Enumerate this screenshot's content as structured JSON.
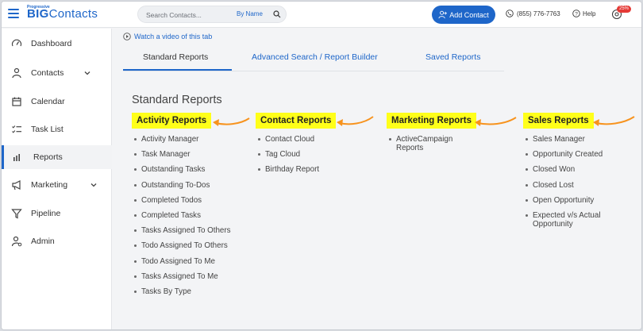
{
  "header": {
    "logo_small": "Progressive",
    "logo_big": "BIG",
    "logo_rest": "Contacts",
    "search_placeholder": "Search Contacts...",
    "search_filter": "By Name",
    "add_contact_label": "Add Contact",
    "phone": "(855) 776-7763",
    "help": "Help",
    "badge": "25%"
  },
  "sidebar": {
    "items": [
      {
        "label": "Dashboard",
        "icon": "gauge-icon"
      },
      {
        "label": "Contacts",
        "icon": "person-icon"
      },
      {
        "label": "Calendar",
        "icon": "calendar-icon"
      },
      {
        "label": "Task List",
        "icon": "checklist-icon"
      },
      {
        "label": "Reports",
        "icon": "bar-chart-icon"
      },
      {
        "label": "Marketing",
        "icon": "megaphone-icon"
      },
      {
        "label": "Pipeline",
        "icon": "funnel-icon"
      },
      {
        "label": "Admin",
        "icon": "admin-icon"
      }
    ],
    "active": "Reports"
  },
  "main": {
    "video_link": "Watch a video of this tab",
    "tabs": [
      {
        "label": "Standard Reports"
      },
      {
        "label": "Advanced Search / Report Builder"
      },
      {
        "label": "Saved Reports"
      }
    ],
    "active_tab": "Standard Reports",
    "section_title": "Standard Reports",
    "columns": [
      {
        "title": "Activity Reports",
        "items": [
          "Activity Manager",
          "Task Manager",
          "Outstanding Tasks",
          "Outstanding To-Dos",
          "Completed Todos",
          "Completed Tasks",
          "Tasks Assigned To Others",
          "Todo Assigned To Others",
          "Todo Assigned To Me",
          "Tasks Assigned To Me",
          "Tasks By Type"
        ]
      },
      {
        "title": "Contact Reports",
        "items": [
          "Contact Cloud",
          "Tag Cloud",
          "Birthday Report"
        ]
      },
      {
        "title": "Marketing Reports",
        "items": [
          "ActiveCampaign Reports"
        ]
      },
      {
        "title": "Sales Reports",
        "items": [
          "Sales Manager",
          "Opportunity Created",
          "Closed Won",
          "Closed Lost",
          "Open Opportunity",
          "Expected v/s Actual Opportunity"
        ]
      }
    ]
  },
  "colors": {
    "accent": "#1e66c9",
    "highlight": "#ffff1a",
    "arrow": "#f7931e",
    "badge": "#e53935"
  }
}
